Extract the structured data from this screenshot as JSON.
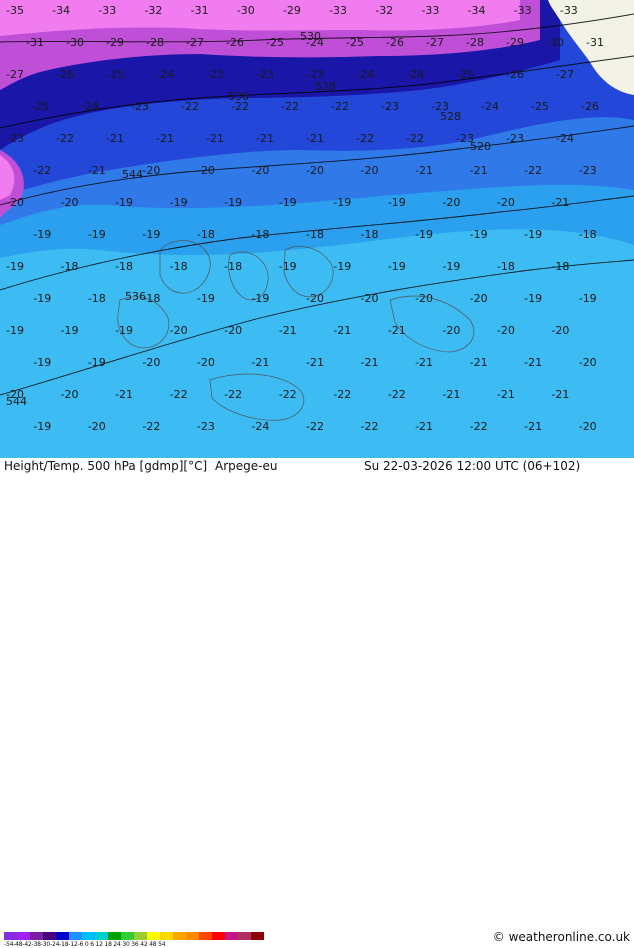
{
  "product": {
    "title": "Height/Temp. 500 hPa [gdmp][°C]",
    "model": "Arpege-eu",
    "valid_time": "Su 22-03-2026 12:00 UTC (06+102)",
    "credit": "© weatheronline.co.uk"
  },
  "legend": {
    "tick_labels": "-54-48-42-38-30-24-18-12-6  0  6  12 18 24 30 36 42 48 54",
    "colors": [
      "#8a2be2",
      "#a020f0",
      "#7b1fa2",
      "#4b0082",
      "#0000cd",
      "#1e90ff",
      "#00bfff",
      "#00ced1",
      "#00a000",
      "#32cd32",
      "#9acd32",
      "#ffff00",
      "#ffd700",
      "#ffa500",
      "#ff8c00",
      "#ff4500",
      "#ff0000",
      "#c71585",
      "#b03060",
      "#8b0000"
    ]
  },
  "map": {
    "colors": {
      "pink": "#f07cf0",
      "violet": "#c04fd8",
      "deep_blue": "#1a16a8",
      "blue": "#2347d8",
      "mid_blue": "#2f7ae8",
      "light_blue": "#2aa0ee",
      "sky": "#3cbcf2",
      "land": "#f2f2e6"
    },
    "temperature_labels": [
      [
        "-35",
        "-34",
        "-33",
        "-32",
        "-31",
        "-30",
        "-29",
        "-33",
        "-32",
        "-33",
        "-34",
        "-33",
        "-33"
      ],
      [
        "-31",
        "-30",
        "-29",
        "-28",
        "-27",
        "-26",
        "-25",
        "-24",
        "-25",
        "-26",
        "-27",
        "-28",
        "-29",
        "-30",
        "-31"
      ],
      [
        "-27",
        "-26",
        "-25",
        "-24",
        "-23",
        "-23",
        "-23",
        "-24",
        "-24",
        "-25",
        "-26",
        "-27"
      ],
      [
        "-25",
        "-24",
        "-23",
        "-22",
        "-22",
        "-22",
        "-22",
        "-23",
        "-23",
        "-24",
        "-25",
        "-26"
      ],
      [
        "-23",
        "-22",
        "-21",
        "-21",
        "-21",
        "-21",
        "-21",
        "-22",
        "-22",
        "-23",
        "-23",
        "-24"
      ],
      [
        "-22",
        "-21",
        "-20",
        "-20",
        "-20",
        "-20",
        "-20",
        "-21",
        "-21",
        "-22",
        "-23"
      ],
      [
        "-20",
        "-20",
        "-19",
        "-19",
        "-19",
        "-19",
        "-19",
        "-19",
        "-20",
        "-20",
        "-21"
      ],
      [
        "-19",
        "-19",
        "-19",
        "-18",
        "-18",
        "-18",
        "-18",
        "-19",
        "-19",
        "-19",
        "-18"
      ],
      [
        "-19",
        "-18",
        "-18",
        "-18",
        "-18",
        "-19",
        "-19",
        "-19",
        "-19",
        "-18",
        "-18"
      ],
      [
        "-19",
        "-18",
        "-18",
        "-19",
        "-19",
        "-20",
        "-20",
        "-20",
        "-20",
        "-19",
        "-19"
      ],
      [
        "-19",
        "-19",
        "-19",
        "-20",
        "-20",
        "-21",
        "-21",
        "-21",
        "-20",
        "-20",
        "-20"
      ],
      [
        "-19",
        "-19",
        "-20",
        "-20",
        "-21",
        "-21",
        "-21",
        "-21",
        "-21",
        "-21",
        "-20"
      ],
      [
        "-20",
        "-20",
        "-21",
        "-22",
        "-22",
        "-22",
        "-22",
        "-22",
        "-21",
        "-21",
        "-21"
      ],
      [
        "-19",
        "-20",
        "-22",
        "-23",
        "-24",
        "-22",
        "-22",
        "-21",
        "-22",
        "-21",
        "-20"
      ]
    ],
    "height_labels": [
      "530",
      "536",
      "536",
      "544",
      "544",
      "528",
      "528",
      "520"
    ]
  }
}
